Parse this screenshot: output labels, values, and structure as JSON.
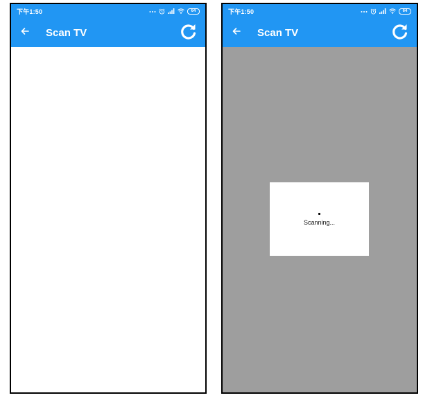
{
  "screens": [
    {
      "status": {
        "time": "下午1:50",
        "battery": "64"
      },
      "appbar": {
        "title": "Scan TV",
        "back_icon": "arrow-left-icon",
        "refresh_icon": "refresh-icon"
      },
      "state": "empty"
    },
    {
      "status": {
        "time": "下午1:50",
        "battery": "64"
      },
      "appbar": {
        "title": "Scan TV",
        "back_icon": "arrow-left-icon",
        "refresh_icon": "refresh-icon"
      },
      "state": "scanning",
      "dialog": {
        "message": "Scanning..."
      }
    }
  ],
  "colors": {
    "primary": "#2196f3",
    "overlay": "#9e9e9e",
    "surface": "#ffffff"
  }
}
